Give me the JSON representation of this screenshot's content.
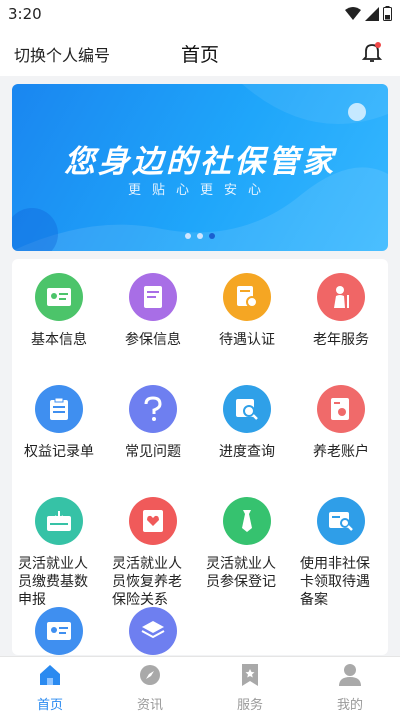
{
  "status_bar": {
    "time": "3:20"
  },
  "header": {
    "switch_label": "切换个人编号",
    "title": "首页"
  },
  "banner": {
    "title": "您身边的社保管家",
    "subtitle": "更贴心更安心"
  },
  "grid": [
    {
      "label": "基本信息",
      "icon": "id-card-icon",
      "color": "#4cc46a"
    },
    {
      "label": "参保信息",
      "icon": "document-icon",
      "color": "#a86ee6"
    },
    {
      "label": "待遇认证",
      "icon": "certificate-icon",
      "color": "#f5a623"
    },
    {
      "label": "老年服务",
      "icon": "elder-icon",
      "color": "#f06666"
    },
    {
      "label": "权益记录单",
      "icon": "clipboard-icon",
      "color": "#3f8ff0"
    },
    {
      "label": "常见问题",
      "icon": "question-icon",
      "color": "#6e7ff0"
    },
    {
      "label": "进度查询",
      "icon": "search-doc-icon",
      "color": "#2fa0e8"
    },
    {
      "label": "养老账户",
      "icon": "account-icon",
      "color": "#f06a6a"
    },
    {
      "label": "灵活就业人员缴费基数申报",
      "icon": "payment-icon",
      "color": "#36c2a6"
    },
    {
      "label": "灵活就业人员恢复养老保险关系",
      "icon": "heart-card-icon",
      "color": "#f05a5a"
    },
    {
      "label": "灵活就业人员参保登记",
      "icon": "tie-icon",
      "color": "#36c26f"
    },
    {
      "label": "使用非社保卡领取待遇备案",
      "icon": "card-search-icon",
      "color": "#2f9ee8"
    },
    {
      "label": "",
      "icon": "id-card-icon",
      "color": "#3f8ff0"
    },
    {
      "label": "",
      "icon": "layers-icon",
      "color": "#6e7ff0"
    }
  ],
  "tabs": [
    {
      "label": "首页",
      "icon": "home-icon",
      "active": true
    },
    {
      "label": "资讯",
      "icon": "compass-icon",
      "active": false
    },
    {
      "label": "服务",
      "icon": "bookmark-icon",
      "active": false
    },
    {
      "label": "我的",
      "icon": "user-icon",
      "active": false
    }
  ],
  "colors": {
    "accent": "#2a8af0",
    "banner": "#1a86f0"
  }
}
